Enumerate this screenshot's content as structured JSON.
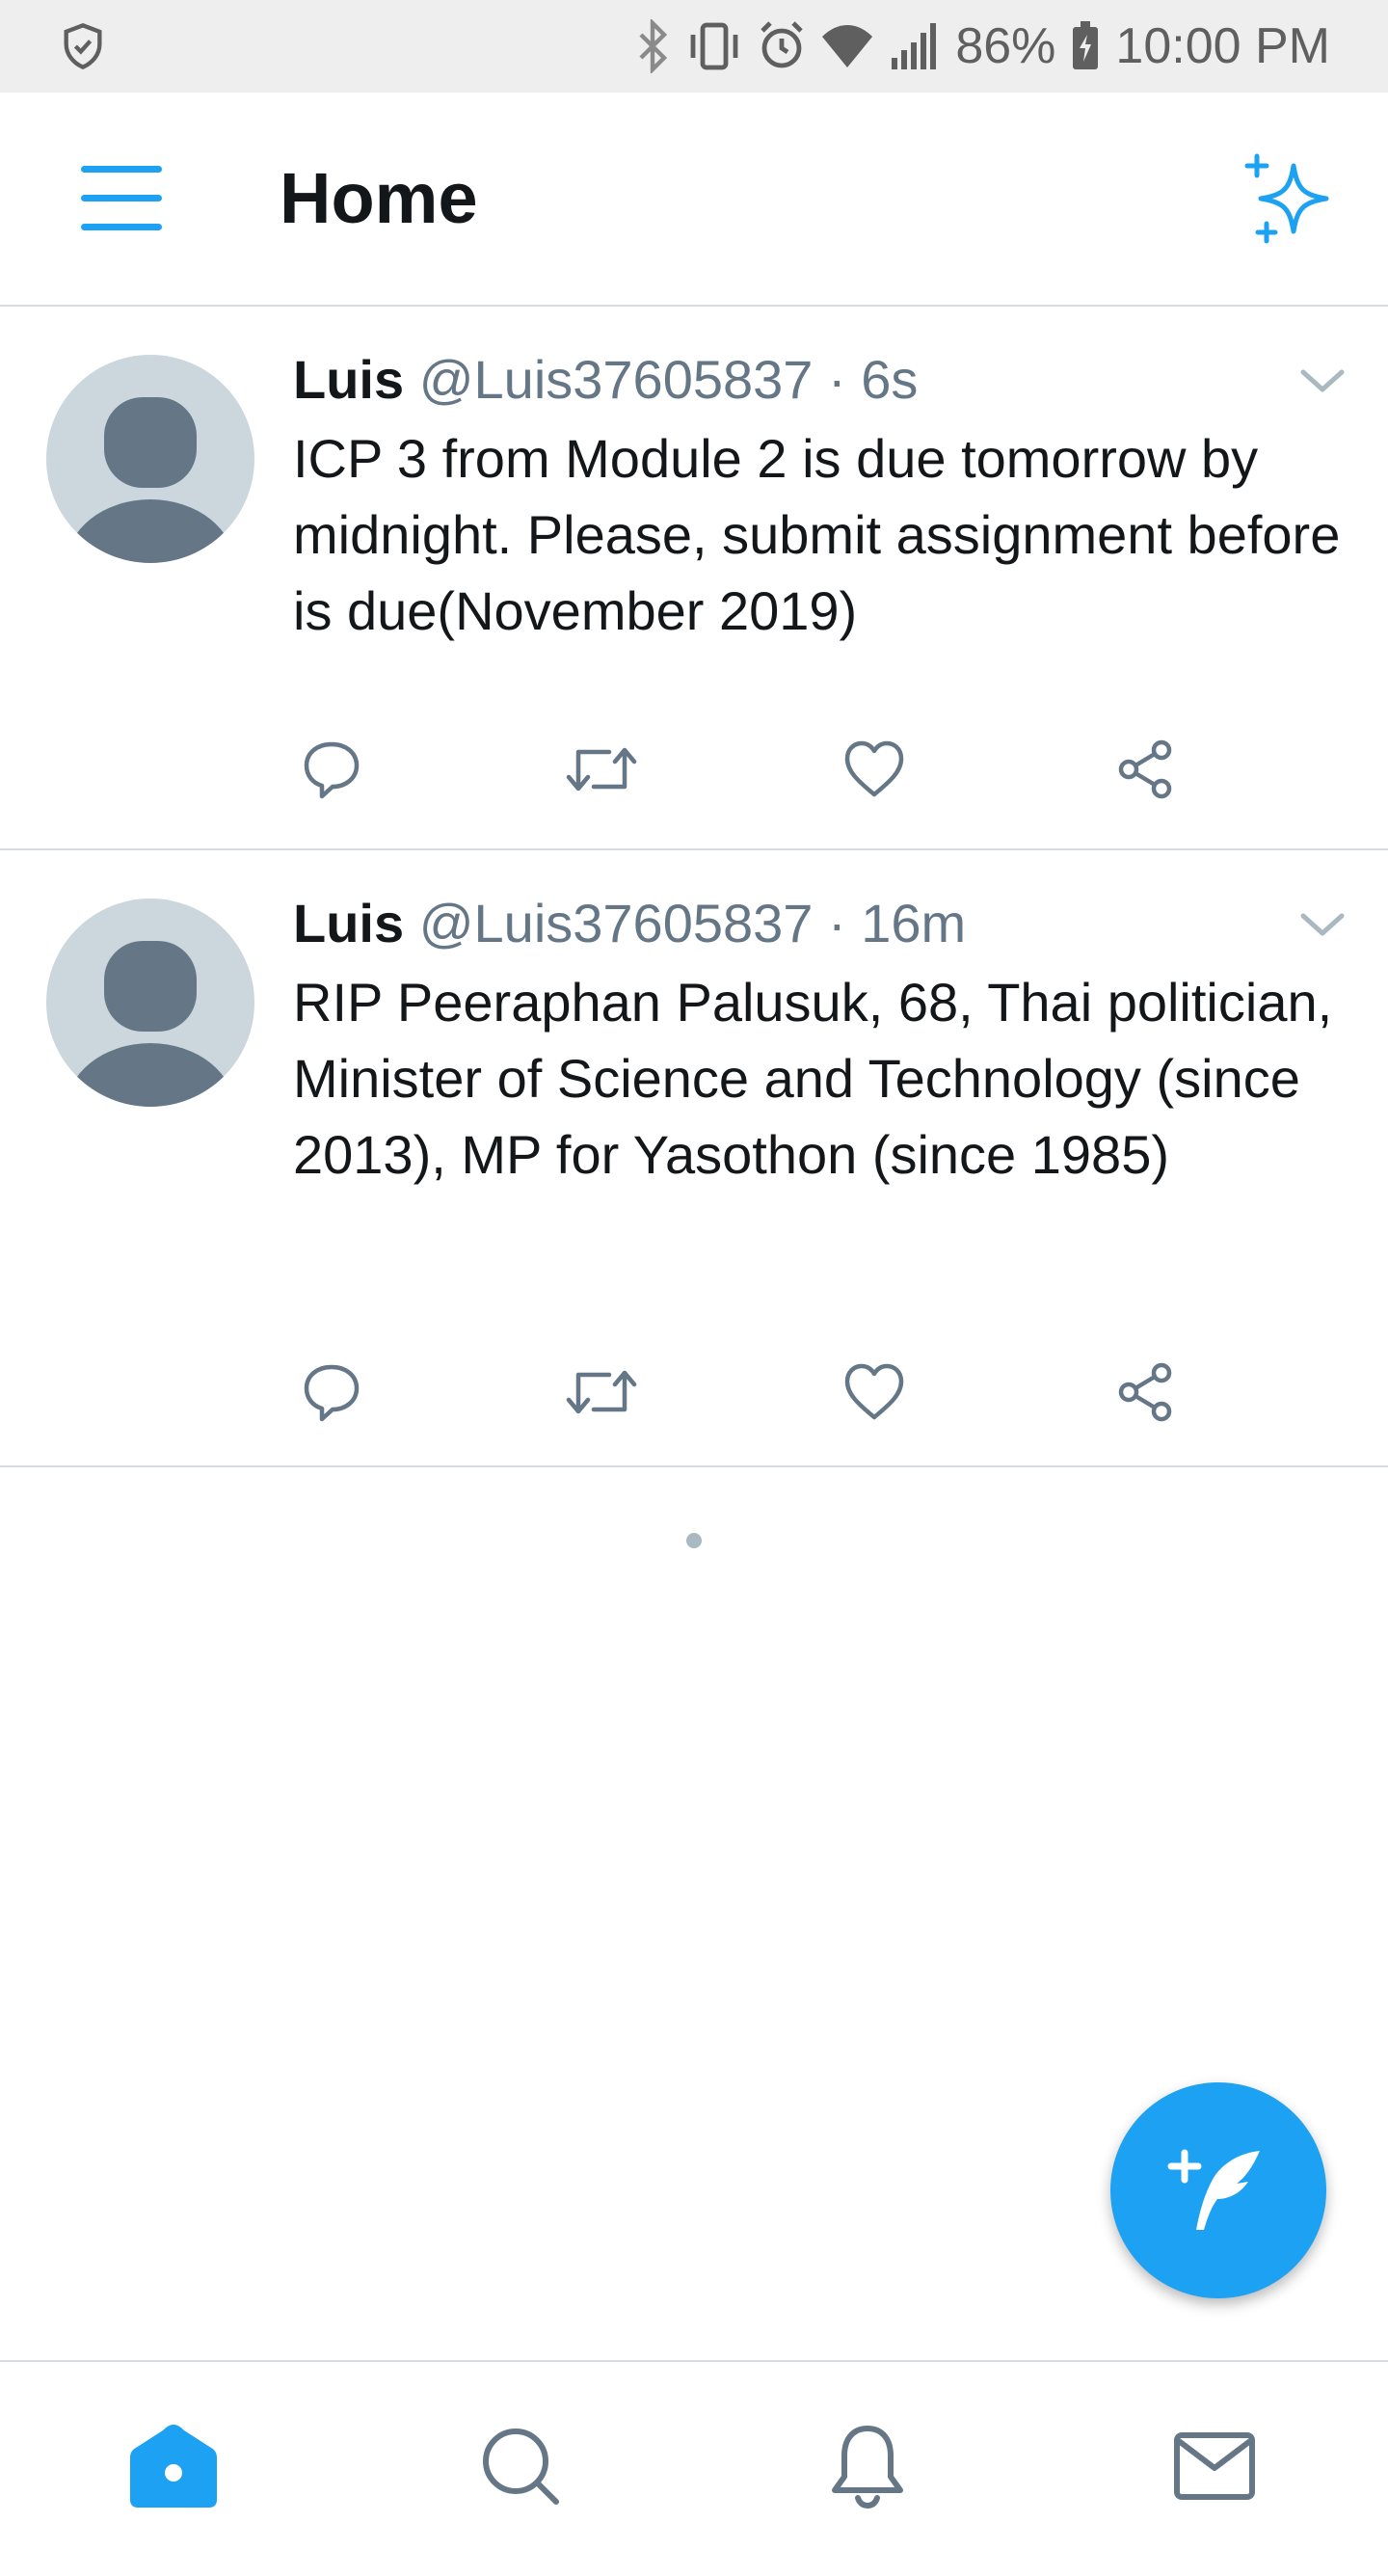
{
  "status_bar": {
    "battery": "86%",
    "time": "10:00 PM",
    "icons": [
      "shield-icon",
      "bluetooth-icon",
      "vibrate-icon",
      "alarm-icon",
      "wifi-icon",
      "signal-icon",
      "battery-charging-icon"
    ]
  },
  "header": {
    "title": "Home",
    "menu_icon": "hamburger-menu-icon",
    "sparkle_icon": "sparkle-icon"
  },
  "tweets": [
    {
      "name": "Luis",
      "handle": "@Luis37605837",
      "time": "6s",
      "text": "ICP 3 from Module 2 is due tomorrow by midnight. Please, submit assignment before is due(November 2019)"
    },
    {
      "name": "Luis",
      "handle": "@Luis37605837",
      "time": "16m",
      "text": "RIP Peeraphan Palusuk, 68, Thai politician, Minister of Science and Technology (since 2013), MP for Yasothon (since 1985)"
    }
  ],
  "separator": "·",
  "fab": {
    "icon": "compose-tweet-icon"
  },
  "bottom_nav": {
    "items": [
      "home-icon",
      "search-icon",
      "notifications-icon",
      "messages-icon"
    ],
    "active": "home-icon"
  },
  "colors": {
    "accent": "#1da1f2",
    "text_primary": "#14171a",
    "text_secondary": "#657786",
    "icon_gray": "#657786",
    "avatar_bg": "#ccd6dd",
    "avatar_fg": "#657786",
    "divider": "#d7dde2",
    "status_bar_bg": "#eeeeee"
  }
}
